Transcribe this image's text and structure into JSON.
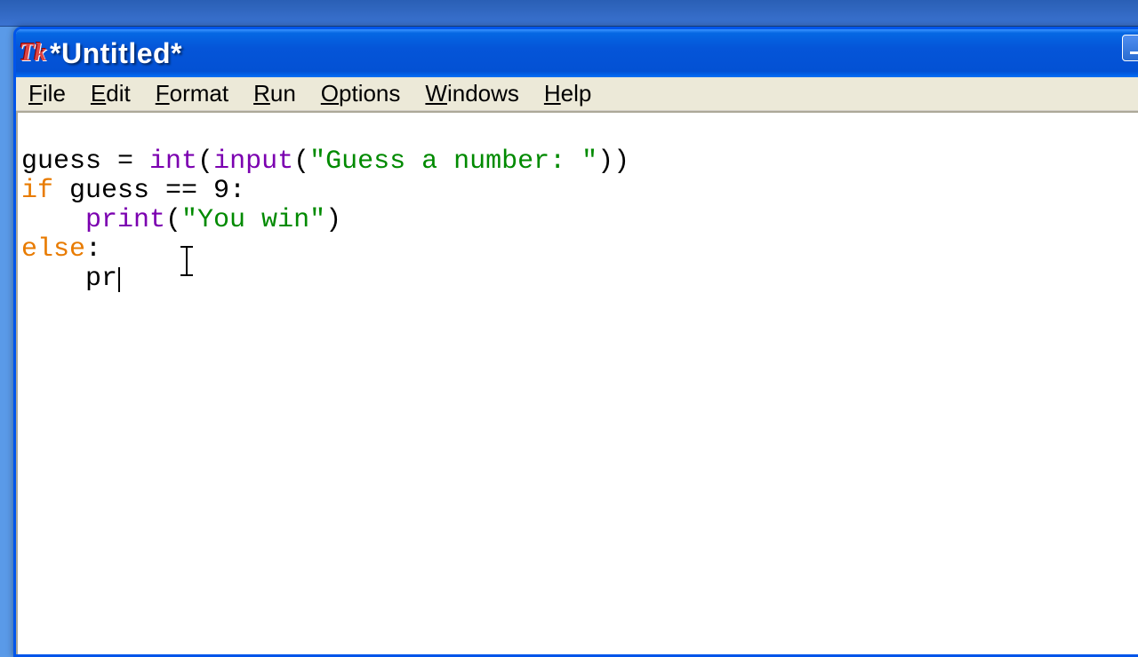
{
  "titlebar": {
    "app_icon_label": "Tk",
    "title": "*Untitled*"
  },
  "menubar": {
    "items": [
      {
        "hot": "F",
        "rest": "ile"
      },
      {
        "hot": "E",
        "rest": "dit"
      },
      {
        "hot": "F",
        "rest": "ormat"
      },
      {
        "hot": "R",
        "rest": "un"
      },
      {
        "hot": "O",
        "rest": "ptions"
      },
      {
        "hot": "W",
        "rest": "indows"
      },
      {
        "hot": "H",
        "rest": "elp"
      }
    ]
  },
  "code": {
    "line1": {
      "t1": "guess = ",
      "fn1": "int",
      "t2": "(",
      "fn2": "input",
      "t3": "(",
      "s1": "\"Guess a number: \"",
      "t4": "))"
    },
    "line2": {
      "kw": "if",
      "rest": " guess == 9:"
    },
    "line3": {
      "indent": "    ",
      "fn": "print",
      "t1": "(",
      "s1": "\"You win\"",
      "t2": ")"
    },
    "line4": {
      "kw": "else",
      "rest": ":"
    },
    "line5": {
      "indent": "    ",
      "txt": "pr"
    }
  }
}
